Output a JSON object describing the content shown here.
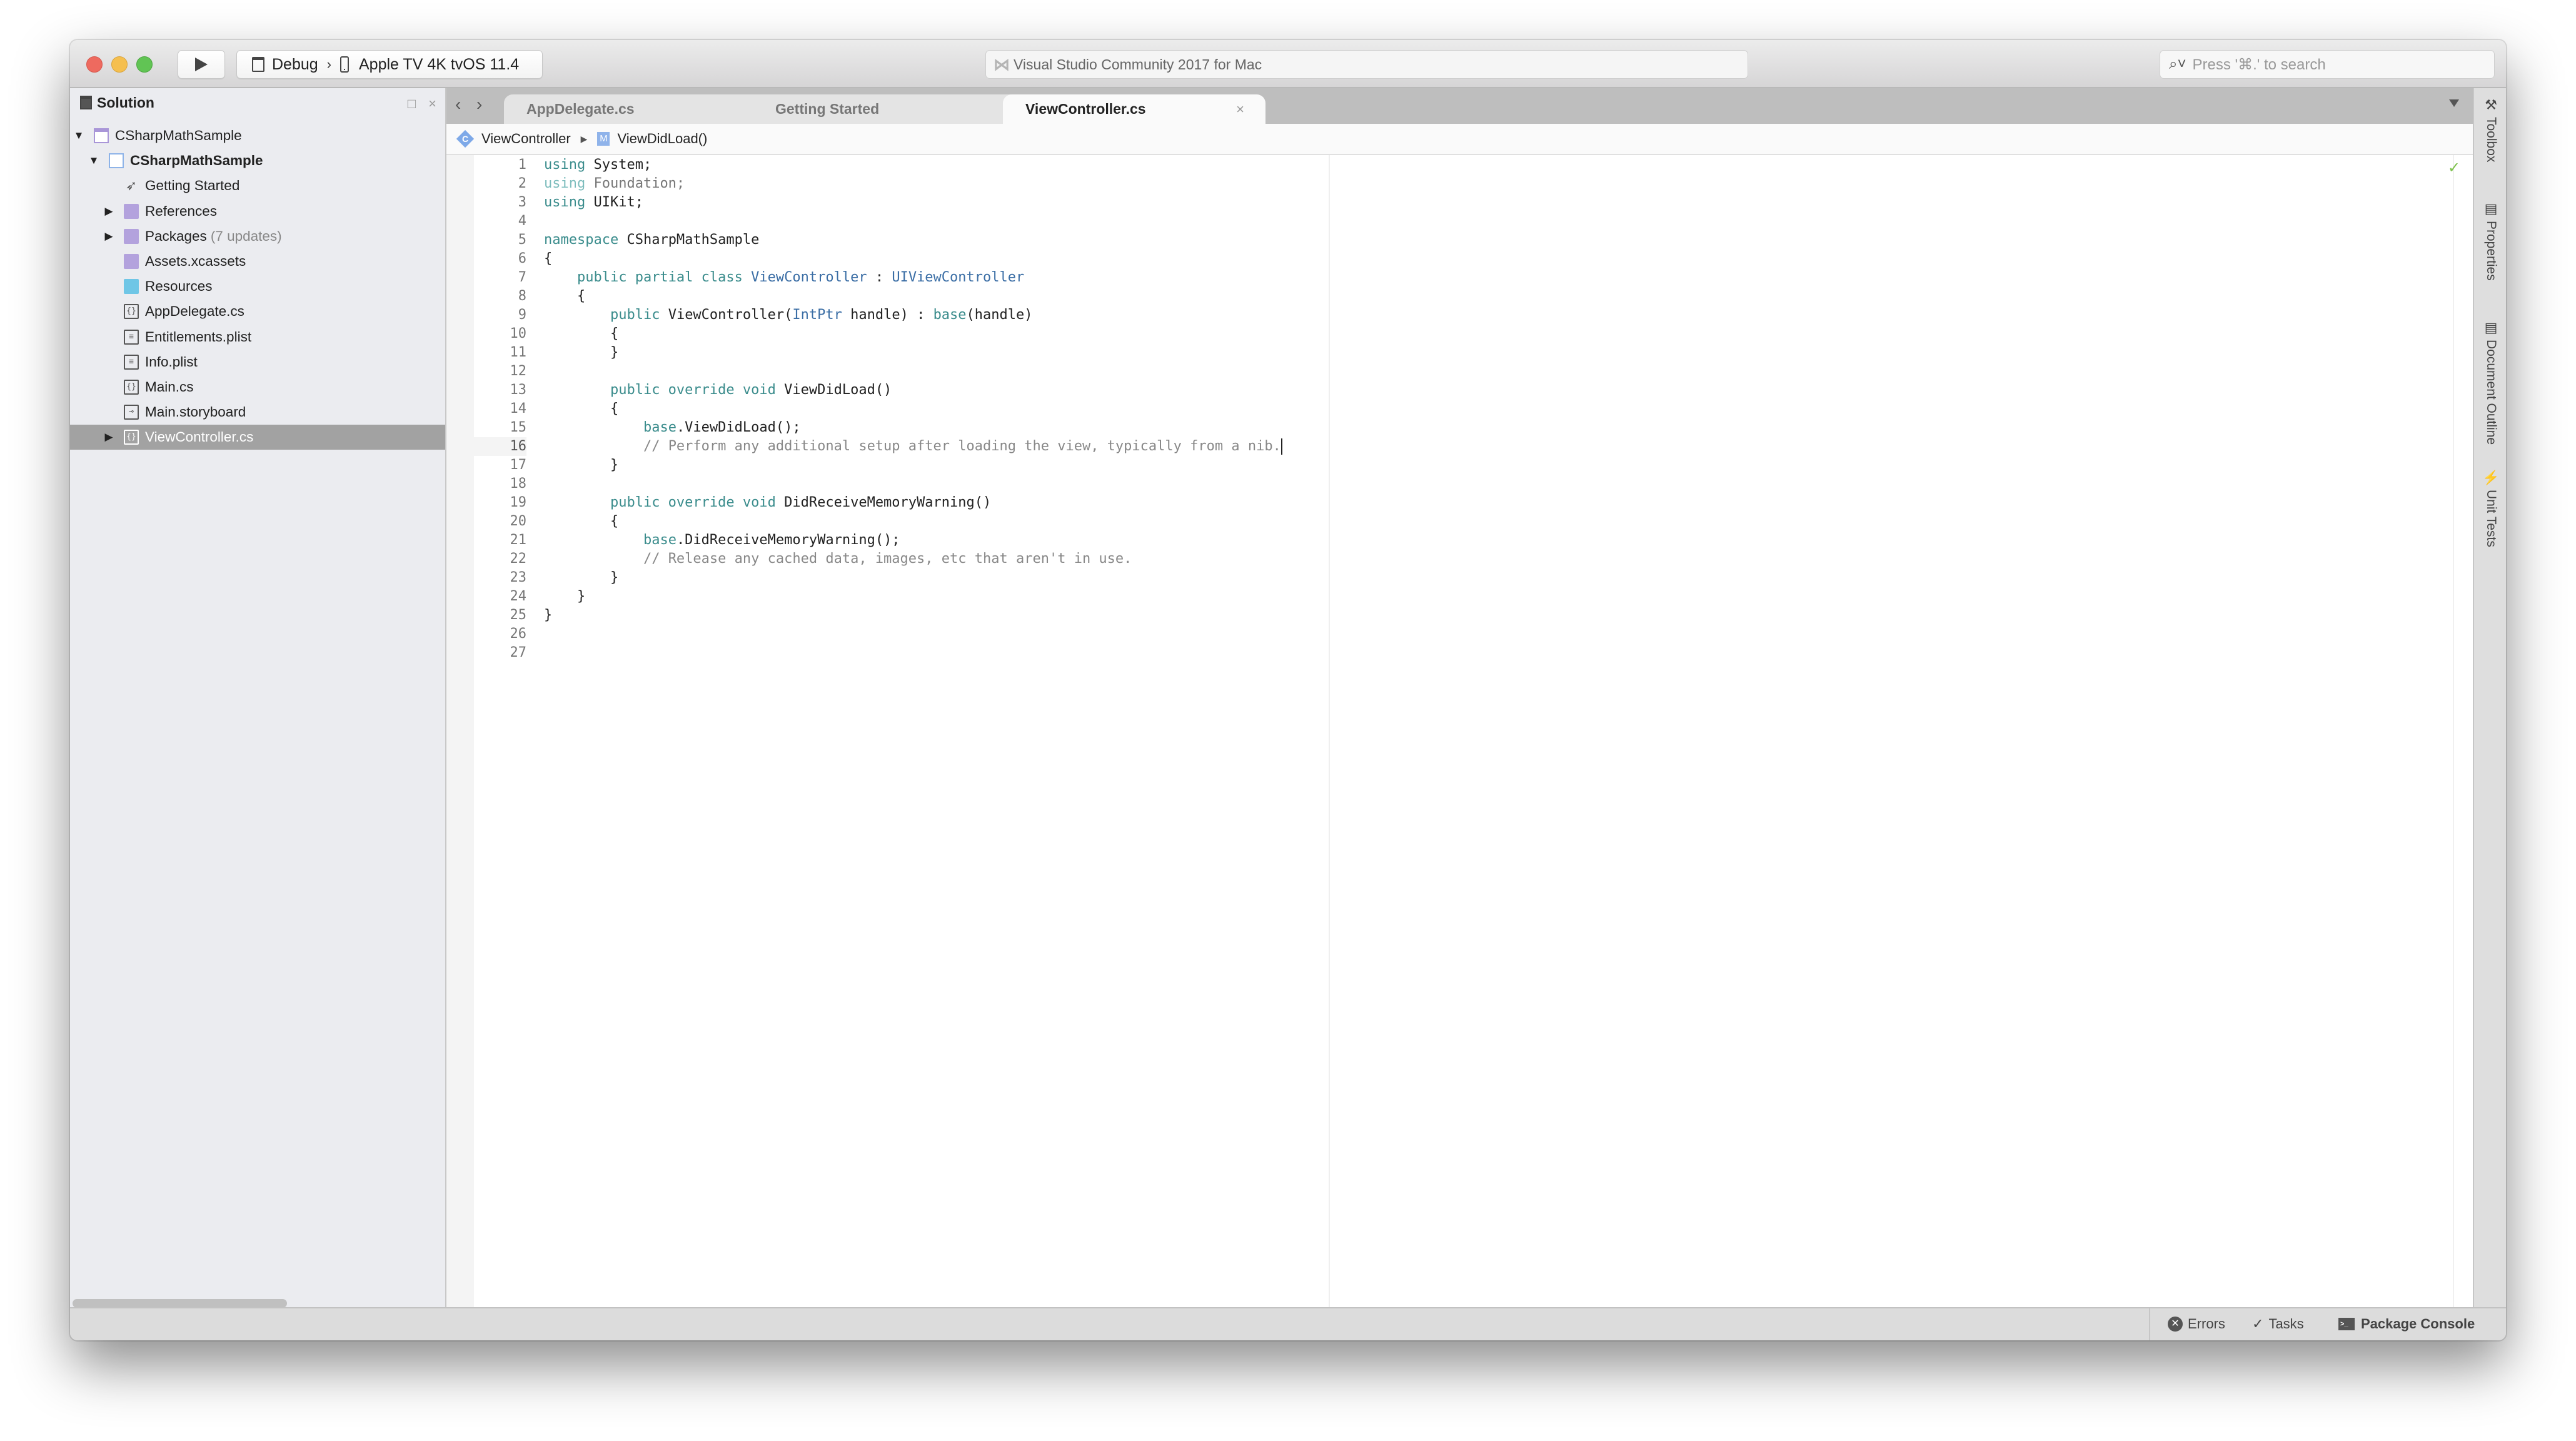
{
  "window": {
    "traffic_lights": [
      "close",
      "minimize",
      "zoom"
    ],
    "colors": {
      "close": "#ee6a5f",
      "minimize": "#f5bf4f",
      "zoom": "#61c454"
    }
  },
  "toolbar": {
    "run_icon": "play-icon",
    "configuration": "Debug",
    "separator": "›",
    "device": "Apple TV 4K tvOS 11.4",
    "status_title": "Visual Studio Community 2017 for Mac",
    "search_placeholder": "Press '⌘.' to search"
  },
  "sidebar": {
    "title": "Solution",
    "controls": {
      "dock": "□",
      "close": "×"
    },
    "tree": [
      {
        "label": "CSharpMathSample",
        "level": 0,
        "expander": "▼",
        "icon": "solution-icon"
      },
      {
        "label": "CSharpMathSample",
        "level": 1,
        "expander": "▼",
        "icon": "project-icon",
        "bold": true
      },
      {
        "label": "Getting Started",
        "level": 2,
        "expander": "",
        "icon": "rocket-icon"
      },
      {
        "label": "References",
        "level": 2,
        "expander": "▶",
        "icon": "references-folder-icon"
      },
      {
        "label": "Packages",
        "extra": "(7 updates)",
        "level": 2,
        "expander": "▶",
        "icon": "packages-folder-icon"
      },
      {
        "label": "Assets.xcassets",
        "level": 2,
        "expander": "",
        "icon": "assets-folder-icon"
      },
      {
        "label": "Resources",
        "level": 2,
        "expander": "",
        "icon": "folder-icon"
      },
      {
        "label": "AppDelegate.cs",
        "level": 2,
        "expander": "",
        "icon": "csharp-file-icon"
      },
      {
        "label": "Entitlements.plist",
        "level": 2,
        "expander": "",
        "icon": "plist-file-icon"
      },
      {
        "label": "Info.plist",
        "level": 2,
        "expander": "",
        "icon": "plist-file-icon"
      },
      {
        "label": "Main.cs",
        "level": 2,
        "expander": "",
        "icon": "csharp-file-icon"
      },
      {
        "label": "Main.storyboard",
        "level": 2,
        "expander": "",
        "icon": "storyboard-file-icon"
      },
      {
        "label": "ViewController.cs",
        "level": 2,
        "expander": "▶",
        "icon": "csharp-file-icon",
        "selected": true
      }
    ]
  },
  "tabs": [
    {
      "label": "AppDelegate.cs",
      "active": false
    },
    {
      "label": "Getting Started",
      "active": false
    },
    {
      "label": "ViewController.cs",
      "active": true,
      "close": "×"
    }
  ],
  "breadcrumb": {
    "class_badge": "C",
    "class_name": "ViewController",
    "separator": "▶",
    "method_badge": "M",
    "method_name": "ViewDidLoad()"
  },
  "editor": {
    "current_line": 16,
    "status_icon": "checkmark-icon",
    "lines": [
      {
        "n": "1",
        "tokens": [
          [
            "kw",
            "using"
          ],
          [
            "",
            " System;"
          ]
        ]
      },
      {
        "n": "2",
        "tokens": [
          [
            "kwd",
            "using"
          ],
          [
            "dim",
            " Foundation;"
          ]
        ]
      },
      {
        "n": "3",
        "tokens": [
          [
            "kw",
            "using"
          ],
          [
            "",
            " UIKit;"
          ]
        ]
      },
      {
        "n": "4",
        "tokens": []
      },
      {
        "n": "5",
        "tokens": [
          [
            "kw",
            "namespace"
          ],
          [
            "",
            " CSharpMathSample"
          ]
        ]
      },
      {
        "n": "6",
        "tokens": [
          [
            "",
            "{"
          ]
        ]
      },
      {
        "n": "7",
        "tokens": [
          [
            "",
            "    "
          ],
          [
            "kw",
            "public partial class"
          ],
          [
            "",
            ""
          ],
          [
            "ty",
            " ViewController"
          ],
          [
            "",
            " : "
          ],
          [
            "ty",
            "UIViewController"
          ]
        ]
      },
      {
        "n": "8",
        "tokens": [
          [
            "",
            "    {"
          ]
        ]
      },
      {
        "n": "9",
        "tokens": [
          [
            "",
            "        "
          ],
          [
            "kw",
            "public"
          ],
          [
            "",
            " ViewController("
          ],
          [
            "ty",
            "IntPtr"
          ],
          [
            "",
            " handle) : "
          ],
          [
            "kw",
            "base"
          ],
          [
            "",
            "(handle)"
          ]
        ]
      },
      {
        "n": "10",
        "tokens": [
          [
            "",
            "        {"
          ]
        ]
      },
      {
        "n": "11",
        "tokens": [
          [
            "",
            "        }"
          ]
        ]
      },
      {
        "n": "12",
        "tokens": []
      },
      {
        "n": "13",
        "tokens": [
          [
            "",
            "        "
          ],
          [
            "kw",
            "public override void"
          ],
          [
            "",
            " ViewDidLoad()"
          ]
        ]
      },
      {
        "n": "14",
        "tokens": [
          [
            "",
            "        {"
          ]
        ]
      },
      {
        "n": "15",
        "tokens": [
          [
            "",
            "            "
          ],
          [
            "kw",
            "base"
          ],
          [
            "",
            ".ViewDidLoad();"
          ]
        ]
      },
      {
        "n": "16",
        "tokens": [
          [
            "",
            "            "
          ],
          [
            "cm",
            "// Perform any additional setup after loading the view, typically from a nib."
          ]
        ],
        "caret": true
      },
      {
        "n": "17",
        "tokens": [
          [
            "",
            "        }"
          ]
        ]
      },
      {
        "n": "18",
        "tokens": []
      },
      {
        "n": "19",
        "tokens": [
          [
            "",
            "        "
          ],
          [
            "kw",
            "public override void"
          ],
          [
            "",
            " DidReceiveMemoryWarning()"
          ]
        ]
      },
      {
        "n": "20",
        "tokens": [
          [
            "",
            "        {"
          ]
        ]
      },
      {
        "n": "21",
        "tokens": [
          [
            "",
            "            "
          ],
          [
            "kw",
            "base"
          ],
          [
            "",
            ".DidReceiveMemoryWarning();"
          ]
        ]
      },
      {
        "n": "22",
        "tokens": [
          [
            "",
            "            "
          ],
          [
            "cm",
            "// Release any cached data, images, etc that aren't in use."
          ]
        ]
      },
      {
        "n": "23",
        "tokens": [
          [
            "",
            "        }"
          ]
        ]
      },
      {
        "n": "24",
        "tokens": [
          [
            "",
            "    }"
          ]
        ]
      },
      {
        "n": "25",
        "tokens": [
          [
            "",
            "}"
          ]
        ]
      },
      {
        "n": "26",
        "tokens": []
      },
      {
        "n": "27",
        "tokens": []
      }
    ]
  },
  "dock": [
    {
      "label": "Toolbox",
      "icon": "hammer-icon",
      "glyph": "⚒"
    },
    {
      "label": "Properties",
      "icon": "properties-icon",
      "glyph": "▤"
    },
    {
      "label": "Document Outline",
      "icon": "document-outline-icon",
      "glyph": "▤"
    },
    {
      "label": "Unit Tests",
      "icon": "lightning-icon",
      "glyph": "⚡"
    }
  ],
  "statusbar": {
    "errors": "Errors",
    "tasks": "Tasks",
    "package_console": "Package Console"
  }
}
